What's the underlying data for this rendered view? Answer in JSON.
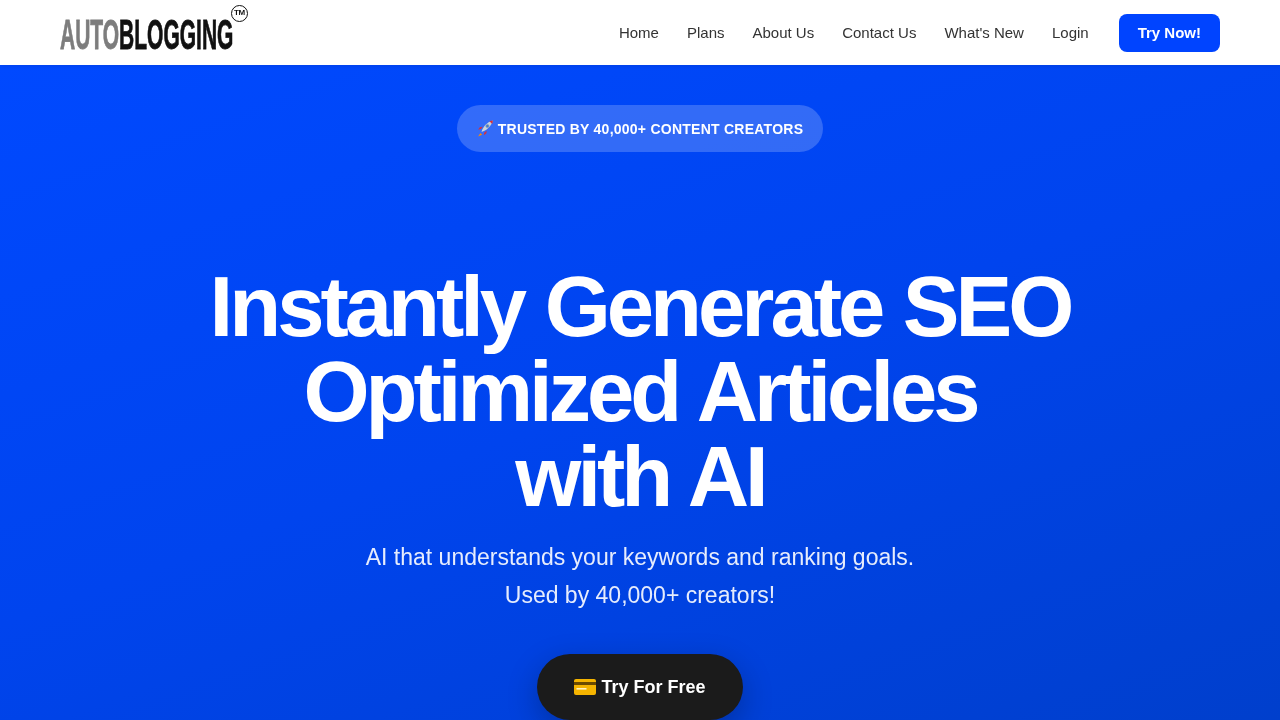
{
  "header": {
    "logo": {
      "parts": [
        {
          "text": "AUTO",
          "color": "#7d7d7d"
        },
        {
          "text": "BLOGGING",
          "color": "#111111"
        }
      ],
      "mark": "TM"
    },
    "nav_links": [
      "Home",
      "Plans",
      "About Us",
      "Contact Us",
      "What's New",
      "Login"
    ],
    "cta": "Try Now!"
  },
  "hero": {
    "badge": "TRUSTED BY 40,000+ CONTENT CREATORS",
    "headline_lines": [
      "Instantly Generate SEO",
      "Optimized Articles",
      "with AI"
    ],
    "subtitle_lines": [
      "AI that understands your keywords and ranking goals.",
      "Used by 40,000+ creators!"
    ],
    "cta": "Try For Free"
  }
}
